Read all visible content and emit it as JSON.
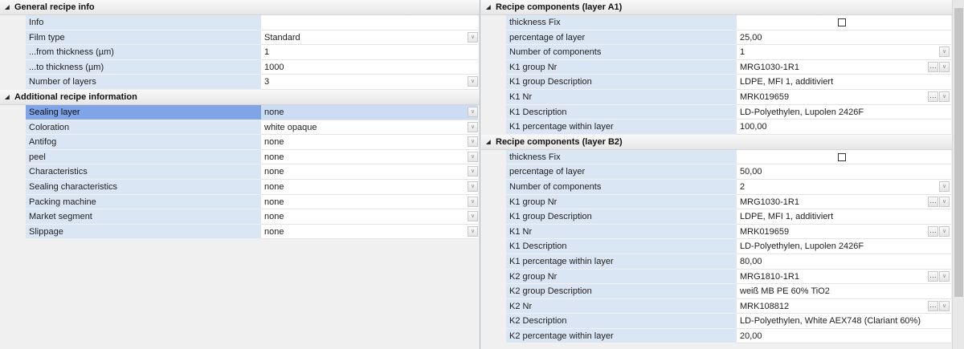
{
  "left": {
    "sections": [
      {
        "title": "General recipe info",
        "rows": [
          {
            "label": "Info",
            "value": "",
            "control": "none"
          },
          {
            "label": "Film type",
            "value": "Standard",
            "control": "dropdown"
          },
          {
            "label": "...from thickness (µm)",
            "value": "1",
            "control": "none"
          },
          {
            "label": "...to thickness  (µm)",
            "value": "1000",
            "control": "none"
          },
          {
            "label": "Number of layers",
            "value": "3",
            "control": "dropdown"
          }
        ]
      },
      {
        "title": "Additional recipe information",
        "rows": [
          {
            "label": "Sealing layer",
            "value": "none",
            "control": "dropdown",
            "selected": true
          },
          {
            "label": "Coloration",
            "value": "white opaque",
            "control": "dropdown"
          },
          {
            "label": "Antifog",
            "value": "none",
            "control": "dropdown"
          },
          {
            "label": "peel",
            "value": "none",
            "control": "dropdown"
          },
          {
            "label": "Characteristics",
            "value": "none",
            "control": "dropdown"
          },
          {
            "label": "Sealing characteristics",
            "value": "none",
            "control": "dropdown"
          },
          {
            "label": "Packing machine",
            "value": "none",
            "control": "dropdown"
          },
          {
            "label": "Market segment",
            "value": "none",
            "control": "dropdown"
          },
          {
            "label": "Slippage",
            "value": "none",
            "control": "dropdown"
          }
        ]
      }
    ]
  },
  "right": {
    "sections": [
      {
        "title": "Recipe components (layer A1)",
        "rows": [
          {
            "label": "thickness Fix",
            "value": "",
            "control": "checkbox",
            "checked": false
          },
          {
            "label": "percentage of layer",
            "value": "25,00",
            "control": "none"
          },
          {
            "label": "Number of components",
            "value": "1",
            "control": "dropdown"
          },
          {
            "label": "K1 group Nr",
            "value": "MRG1030-1R1",
            "control": "dots-dropdown"
          },
          {
            "label": "K1 group Description",
            "value": "LDPE, MFI 1, additiviert",
            "control": "none"
          },
          {
            "label": "K1 Nr",
            "value": "MRK019659",
            "control": "dots-dropdown"
          },
          {
            "label": "K1 Description",
            "value": "LD-Polyethylen, Lupolen 2426F",
            "control": "none"
          },
          {
            "label": "K1 percentage within layer",
            "value": "100,00",
            "control": "none"
          }
        ]
      },
      {
        "title": "Recipe components (layer B2)",
        "rows": [
          {
            "label": "thickness Fix",
            "value": "",
            "control": "checkbox",
            "checked": false
          },
          {
            "label": "percentage of layer",
            "value": "50,00",
            "control": "none"
          },
          {
            "label": "Number of components",
            "value": "2",
            "control": "dropdown"
          },
          {
            "label": "K1 group Nr",
            "value": "MRG1030-1R1",
            "control": "dots-dropdown"
          },
          {
            "label": "K1 group Description",
            "value": "LDPE, MFI 1, additiviert",
            "control": "none"
          },
          {
            "label": "K1 Nr",
            "value": "MRK019659",
            "control": "dots-dropdown"
          },
          {
            "label": "K1 Description",
            "value": "LD-Polyethylen, Lupolen 2426F",
            "control": "none"
          },
          {
            "label": "K1 percentage within layer",
            "value": "80,00",
            "control": "none"
          },
          {
            "label": "K2 group Nr",
            "value": "MRG1810-1R1",
            "control": "dots-dropdown"
          },
          {
            "label": "K2 group Description",
            "value": "weiß MB PE 60% TiO2",
            "control": "none"
          },
          {
            "label": "K2 Nr",
            "value": "MRK108812",
            "control": "dots-dropdown"
          },
          {
            "label": "K2 Description",
            "value": "LD-Polyethylen, White AEX748 (Clariant 60%)",
            "control": "none"
          },
          {
            "label": "K2 percentage within layer",
            "value": "20,00",
            "control": "none"
          }
        ]
      }
    ]
  },
  "icons": {
    "collapse": "triangle-down-icon",
    "dropdown": "chevron-down-icon",
    "dots": "ellipsis-icon"
  },
  "colors": {
    "label_bg": "#dbe6f5",
    "selected_label_bg": "#7fa4e8",
    "value_bg": "#ffffff"
  }
}
